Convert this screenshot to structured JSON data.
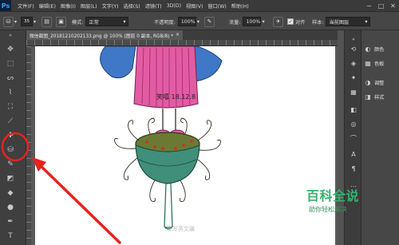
{
  "app": {
    "logo": "Ps"
  },
  "menu": [
    "文件(F)",
    "编辑(E)",
    "图像(I)",
    "图层(L)",
    "文字(Y)",
    "选择(S)",
    "滤镜(T)",
    "3D(D)",
    "视图(V)",
    "窗口(W)",
    "帮助(H)"
  ],
  "window_controls": {
    "minimize": "−",
    "maximize": "□",
    "close": "✕"
  },
  "options_bar": {
    "brush_size": "35",
    "mode_label": "模式:",
    "mode_value": "正常",
    "opacity_label": "不透明度:",
    "opacity_value": "100%",
    "flow_label": "流量:",
    "flow_value": "100%",
    "align_label": "对齐",
    "sample_label": "样本:",
    "sample_value": "当前图层"
  },
  "document_tab": {
    "title": "微信截图_20181210202133.png @ 100% (图层 0 副本, RGB/8) *",
    "close": "×"
  },
  "panels": [
    {
      "icon": "palette-icon",
      "label": "颜色"
    },
    {
      "icon": "swatches-icon",
      "label": "色板"
    },
    {
      "icon": "adjustments-icon",
      "label": "调整"
    },
    {
      "icon": "styles-icon",
      "label": "样式"
    }
  ],
  "drawing_text": "笑嘻 18.12.8 ",
  "watermark": {
    "brand": "百科全说",
    "slogan": "助你轻松解决",
    "weibo": "@写英文疆"
  },
  "colors": {
    "annotation_red": "#e8221d",
    "skirt_pink": "#e25ba3",
    "wing_blue": "#3f78c6",
    "lotus_green": "#3f8f7b",
    "brand_green": "#35b26b"
  }
}
